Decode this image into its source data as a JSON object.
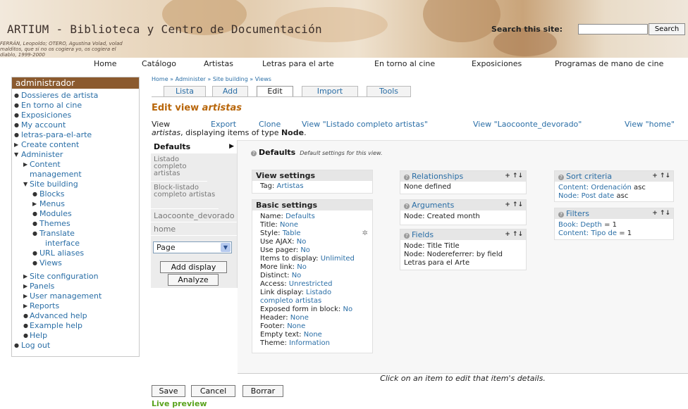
{
  "header": {
    "site_title": "ARTIUM - Biblioteca y Centro de Documentación",
    "quote": "FERRÁN, Leopoldo; OTERO, Agustina Volad, volad malditos, que si no os cogiera yo, os cogiera el diablo, 1999-2000",
    "search_label": "Search this site:",
    "search_button": "Search",
    "search_value": ""
  },
  "primary_nav": [
    "Home",
    "Catálogo",
    "Artistas",
    "Letras para el arte",
    "En torno al cine",
    "Exposiciones",
    "Programas de mano de cine"
  ],
  "sidebar": {
    "title": "administrador",
    "items": [
      {
        "label": "Dossieres de artista"
      },
      {
        "label": "En torno al cine"
      },
      {
        "label": "Exposiciones"
      },
      {
        "label": "My account"
      },
      {
        "label": "letras-para-el-arte"
      },
      {
        "label": "Create content"
      },
      {
        "label": "Administer"
      },
      {
        "label": "Content"
      },
      {
        "label": "management"
      },
      {
        "label": "Site building"
      },
      {
        "label": "Blocks"
      },
      {
        "label": "Menus"
      },
      {
        "label": "Modules"
      },
      {
        "label": "Themes"
      },
      {
        "label": "Translate"
      },
      {
        "label": "interface"
      },
      {
        "label": "URL aliases"
      },
      {
        "label": "Views"
      },
      {
        "label": "Site configuration"
      },
      {
        "label": "Panels"
      },
      {
        "label": "User management"
      },
      {
        "label": "Reports"
      },
      {
        "label": "Advanced help"
      },
      {
        "label": "Example help"
      },
      {
        "label": "Help"
      },
      {
        "label": "Log out"
      }
    ]
  },
  "breadcrumb": "Home » Administer » Site building » Views",
  "tabs": [
    "Lista",
    "Add",
    "Edit",
    "Import",
    "Tools"
  ],
  "page_title_prefix": "Edit view ",
  "page_title_name": "artistas",
  "view_links": [
    "View",
    "Export",
    "Clone",
    "View \"Listado completo artistas\"",
    "View \"Laocoonte_devorado\"",
    "View \"home\""
  ],
  "view_desc": {
    "name": "artistas",
    "middle": ", displaying items of type ",
    "type": "Node",
    "end": "."
  },
  "displays": {
    "items": [
      "Defaults",
      "Listado completo artistas",
      "Block-listado completo artistas",
      "Laocoonte_devorado",
      "home"
    ],
    "select_value": "Page",
    "add_button": "Add display",
    "analyze_button": "Analyze"
  },
  "defaults_head": {
    "title": "Defaults",
    "desc": "Default settings for this view."
  },
  "view_settings": {
    "title": "View settings",
    "tag_label": "Tag:",
    "tag_value": "Artistas"
  },
  "basic_settings": {
    "title": "Basic settings",
    "rows": [
      {
        "label": "Name:",
        "value": "Defaults"
      },
      {
        "label": "Title:",
        "value": "None"
      },
      {
        "label": "Style:",
        "value": "Table"
      },
      {
        "label": "Use AJAX:",
        "value": "No"
      },
      {
        "label": "Use pager:",
        "value": "No"
      },
      {
        "label": "Items to display:",
        "value": "Unlimited"
      },
      {
        "label": "More link:",
        "value": "No"
      },
      {
        "label": "Distinct:",
        "value": "No"
      },
      {
        "label": "Access:",
        "value": "Unrestricted"
      },
      {
        "label": "Link display:",
        "value": "Listado"
      },
      {
        "label": "",
        "value": "completo artistas"
      },
      {
        "label": "Exposed form in block:",
        "value": "No"
      },
      {
        "label": "Header:",
        "value": "None"
      },
      {
        "label": "Footer:",
        "value": "None"
      },
      {
        "label": "Empty text:",
        "value": "None"
      },
      {
        "label": "Theme:",
        "value": "Information"
      }
    ]
  },
  "relationships": {
    "title": "Relationships",
    "ops": "+ ↑↓",
    "rows": [
      "None defined"
    ]
  },
  "arguments": {
    "title": "Arguments",
    "ops": "+ ↑↓",
    "rows": [
      "Node: Created month"
    ]
  },
  "fields": {
    "title": "Fields",
    "ops": "+ ↑↓",
    "rows": [
      "Node: Title Title",
      "Node: Nodereferrer: by field",
      "Letras para el Arte"
    ]
  },
  "sort_criteria": {
    "title": "Sort criteria",
    "ops": "+ ↑↓",
    "rows": [
      {
        "value": "Content: Ordenación",
        "suffix": " asc"
      },
      {
        "value": "Node: Post date",
        "suffix": " asc"
      }
    ]
  },
  "filters": {
    "title": "Filters",
    "ops": "+ ↑↓",
    "rows": [
      {
        "value": "Book: Depth",
        "suffix": " = 1"
      },
      {
        "value": "Content: Tipo de",
        "suffix": " = 1"
      }
    ]
  },
  "footer_msg": "Click on an item to edit that item's details.",
  "buttons": {
    "save": "Save",
    "cancel": "Cancel",
    "delete": "Borrar"
  },
  "live_preview": "Live preview"
}
